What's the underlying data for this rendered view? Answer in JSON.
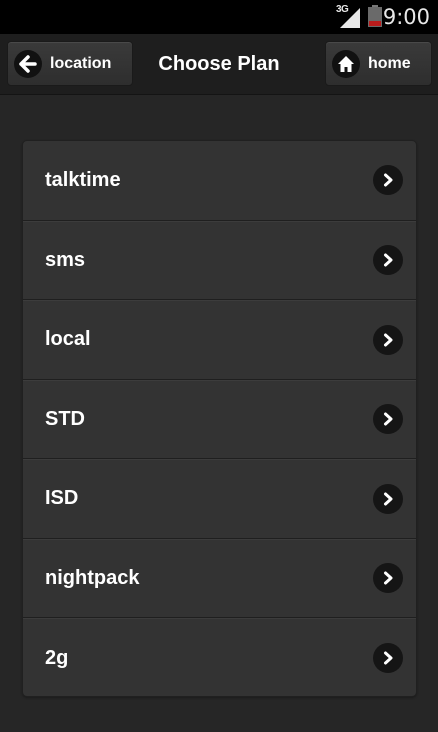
{
  "status_bar": {
    "network": "3G",
    "time": "9:00",
    "icons": [
      "signal-icon",
      "battery-icon"
    ]
  },
  "header": {
    "back_label": "location",
    "back_icon": "arrow-left-icon",
    "title": "Choose Plan",
    "home_label": "home",
    "home_icon": "home-icon"
  },
  "plans": [
    {
      "label": "talktime",
      "icon": "chevron-right-icon"
    },
    {
      "label": "sms",
      "icon": "chevron-right-icon"
    },
    {
      "label": "local",
      "icon": "chevron-right-icon"
    },
    {
      "label": "STD",
      "icon": "chevron-right-icon"
    },
    {
      "label": "ISD",
      "icon": "chevron-right-icon"
    },
    {
      "label": "nightpack",
      "icon": "chevron-right-icon"
    },
    {
      "label": "2g",
      "icon": "chevron-right-icon"
    }
  ],
  "colors": {
    "background": "#262626",
    "header": "#1e1e1e",
    "list_item": "#333333",
    "battery_low": "#b91c1c"
  }
}
